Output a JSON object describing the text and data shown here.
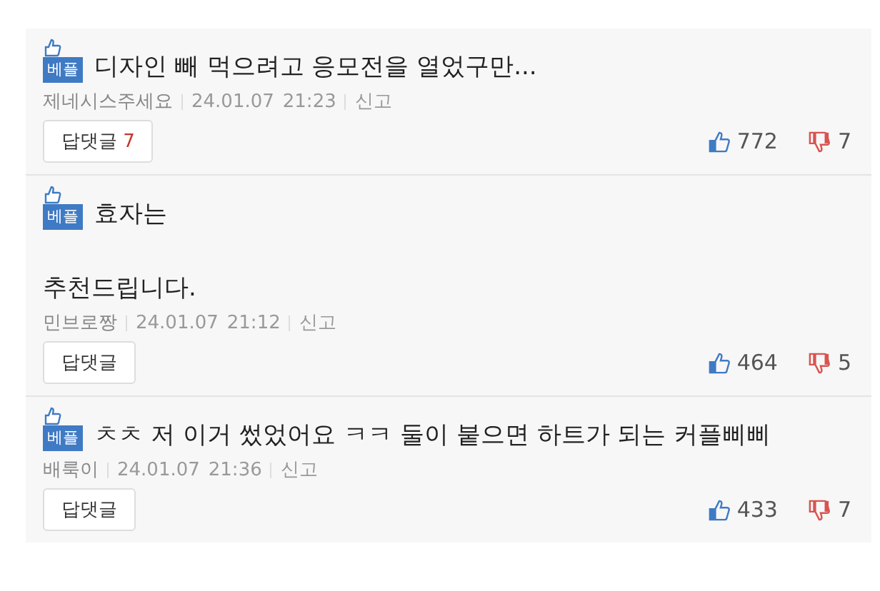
{
  "comments": [
    {
      "badge": "베플",
      "lines": [
        "디자인 빼 먹으려고 응모전을 열었구만..."
      ],
      "author": "제네시스주세요",
      "date": "24.01.07",
      "time": "21:23",
      "report": "신고",
      "reply_label": "답댓글",
      "reply_count": "7",
      "likes": "772",
      "dislikes": "7"
    },
    {
      "badge": "베플",
      "lines": [
        "효자는",
        "추천드립니다."
      ],
      "author": "민브로짱",
      "date": "24.01.07",
      "time": "21:12",
      "report": "신고",
      "reply_label": "답댓글",
      "likes": "464",
      "dislikes": "5"
    },
    {
      "badge": "베플",
      "lines": [
        "ㅊㅊ 저 이거 썼었어요 ㅋㅋ 둘이 붙으면 하트가 되는 커플삐삐"
      ],
      "author": "배룩이",
      "date": "24.01.07",
      "time": "21:36",
      "report": "신고",
      "reply_label": "답댓글",
      "likes": "433",
      "dislikes": "7"
    }
  ]
}
